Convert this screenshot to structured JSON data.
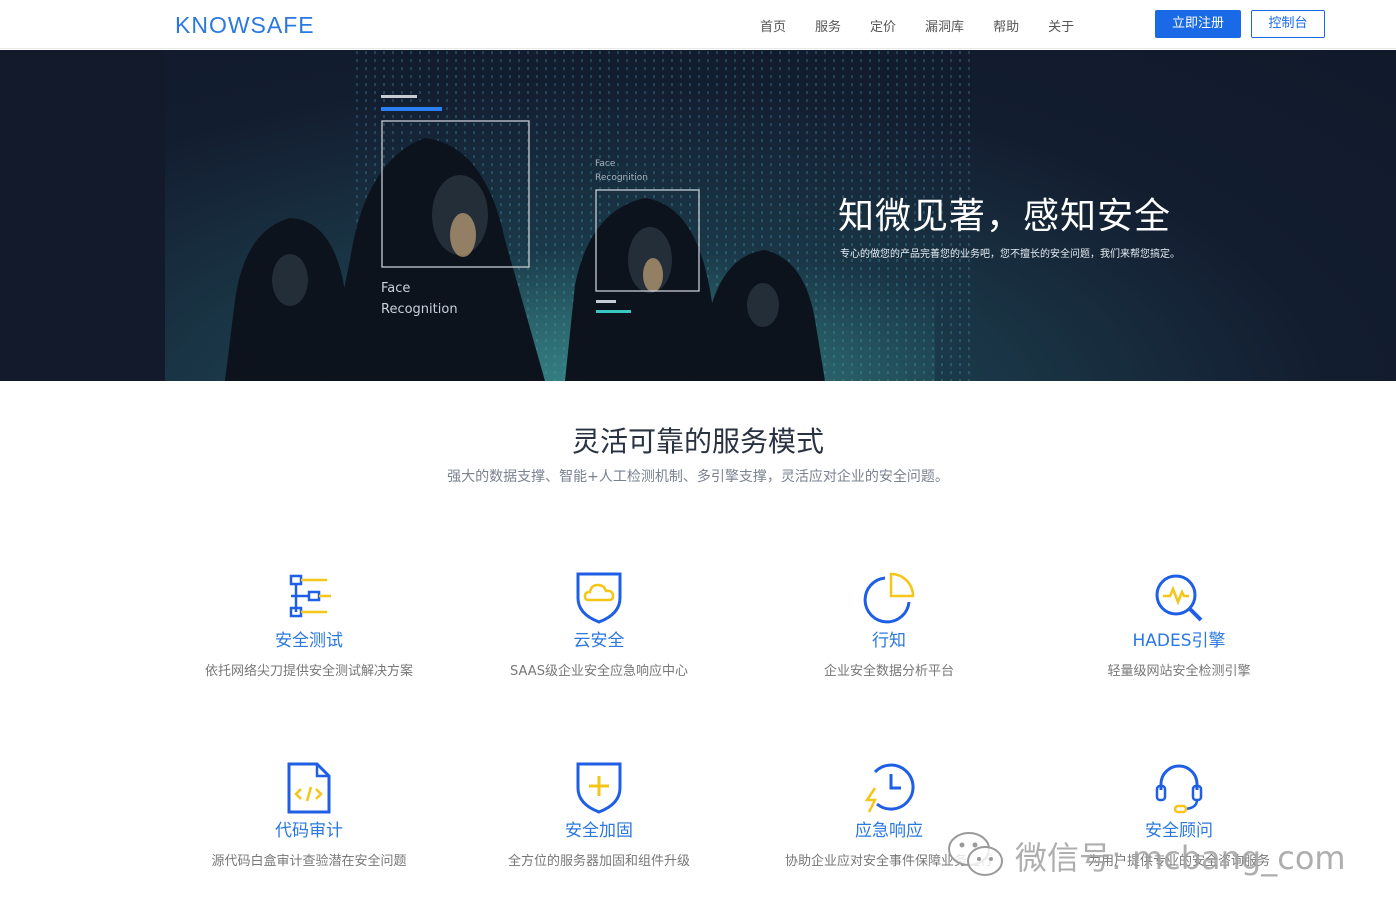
{
  "header": {
    "logo": "KNOWSAFE",
    "nav": [
      "首页",
      "服务",
      "定价",
      "漏洞库",
      "帮助",
      "关于"
    ],
    "register_label": "立即注册",
    "console_label": "控制台"
  },
  "hero": {
    "title": "知微见著，感知安全",
    "subtitle": "专心的做您的产品完善您的业务吧，您不擅长的安全问题，我们来帮您搞定。",
    "face_label_1_line1": "Face",
    "face_label_1_line2": "Recognition",
    "face_label_2_line1": "Face",
    "face_label_2_line2": "Recognition"
  },
  "section": {
    "title": "灵活可靠的服务模式",
    "subtitle": "强大的数据支撑、智能+人工检测机制、多引擎支撑，灵活应对企业的安全问题。"
  },
  "services": [
    {
      "name": "安全测试",
      "desc": "依托网络尖刀提供安全测试解决方案",
      "icon": "sliders-icon"
    },
    {
      "name": "云安全",
      "desc": "SAAS级企业安全应急响应中心",
      "icon": "cloud-shield-icon"
    },
    {
      "name": "行知",
      "desc": "企业安全数据分析平台",
      "icon": "pie-chart-icon"
    },
    {
      "name": "HADES引擎",
      "desc": "轻量级网站安全检测引擎",
      "icon": "search-pulse-icon"
    },
    {
      "name": "代码审计",
      "desc": "源代码白盒审计查验潜在安全问题",
      "icon": "code-file-icon"
    },
    {
      "name": "安全加固",
      "desc": "全方位的服务器加固和组件升级",
      "icon": "shield-plus-icon"
    },
    {
      "name": "应急响应",
      "desc": "协助企业应对安全事件保障业务运行",
      "icon": "clock-bolt-icon"
    },
    {
      "name": "安全顾问",
      "desc": "为用户提供专业的安全咨询服务",
      "icon": "headset-icon"
    }
  ],
  "watermark": {
    "text": "微信号: mcbang_com"
  },
  "colors": {
    "accent": "#1a6ae8",
    "icon_blue": "#1f5fe6",
    "icon_yellow": "#f5c518",
    "banner_dark": "#121a2c"
  }
}
